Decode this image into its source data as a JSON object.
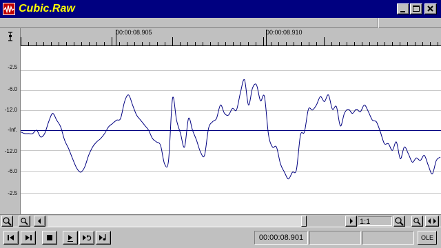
{
  "window": {
    "title": "Cubic.Raw",
    "title_color": "#ffff00",
    "titlebar_color": "#000080",
    "icons": {
      "app": "waveform-app-icon",
      "minimize": "minimize-icon",
      "maximize": "maximize-icon",
      "close": "close-icon"
    }
  },
  "ruler": {
    "ticks": [
      {
        "label": "00:00:08.905"
      },
      {
        "label": "00:00:08.910"
      }
    ],
    "cursor_icon": "text-cursor-icon"
  },
  "scale": {
    "labels": [
      "-2.5",
      "-6.0",
      "-12.0",
      "-Inf.",
      "-12.0",
      "-6.0",
      "-2.5"
    ]
  },
  "chart_data": {
    "type": "line",
    "ylabel": "",
    "xlabel": "",
    "ylim": [
      -1,
      1
    ],
    "grid": true,
    "line_color": "#000080",
    "series": [
      {
        "values": [
          -0.02,
          -0.04,
          -0.04,
          -0.04,
          0.0,
          -0.08,
          -0.04,
          0.1,
          0.2,
          0.12,
          0.04,
          -0.12,
          -0.22,
          -0.34,
          -0.45,
          -0.5,
          -0.44,
          -0.3,
          -0.2,
          -0.14,
          -0.1,
          -0.04,
          0.04,
          0.08,
          0.12,
          0.14,
          0.34,
          0.42,
          0.3,
          0.18,
          0.12,
          0.06,
          0.0,
          -0.1,
          -0.14,
          -0.18,
          -0.4,
          -0.36,
          0.38,
          0.12,
          -0.04,
          -0.2,
          0.14,
          0.0,
          -0.12,
          -0.26,
          -0.3,
          0.02,
          0.1,
          0.14,
          0.3,
          0.2,
          0.18,
          0.26,
          0.24,
          0.45,
          0.6,
          0.3,
          0.5,
          0.54,
          0.35,
          0.4,
          -0.05,
          -0.2,
          -0.2,
          -0.4,
          -0.5,
          -0.58,
          -0.5,
          -0.47,
          -0.06,
          -0.02,
          0.25,
          0.24,
          0.3,
          0.4,
          0.34,
          0.42,
          0.25,
          0.28,
          0.05,
          0.2,
          0.25,
          0.2,
          0.25,
          0.22,
          0.3,
          0.22,
          0.12,
          0.1,
          -0.02,
          -0.16,
          -0.16,
          -0.24,
          -0.14,
          -0.34,
          -0.2,
          -0.28,
          -0.38,
          -0.33,
          -0.36,
          -0.3,
          -0.42,
          -0.52,
          -0.36,
          -0.32
        ]
      }
    ]
  },
  "scrollbar": {
    "zoom_ratio": "1:1",
    "icons": {
      "zoom_in_left": "zoom-in-icon",
      "zoom_out_left": "zoom-out-icon",
      "scroll_left": "scroll-left-icon",
      "scroll_right": "scroll-right-icon",
      "zoom_in_right": "zoom-in-icon",
      "zoom_out_right": "zoom-out-icon",
      "zoom_full": "zoom-full-icon"
    }
  },
  "transport": {
    "position": "00:00:08.901",
    "ole_label": "OLE",
    "icons": {
      "go_start": "skip-to-start-icon",
      "go_end": "skip-to-end-icon",
      "stop": "stop-icon",
      "play": "play-icon",
      "play_loop": "play-loop-icon",
      "play_to_end": "play-to-end-icon"
    }
  }
}
